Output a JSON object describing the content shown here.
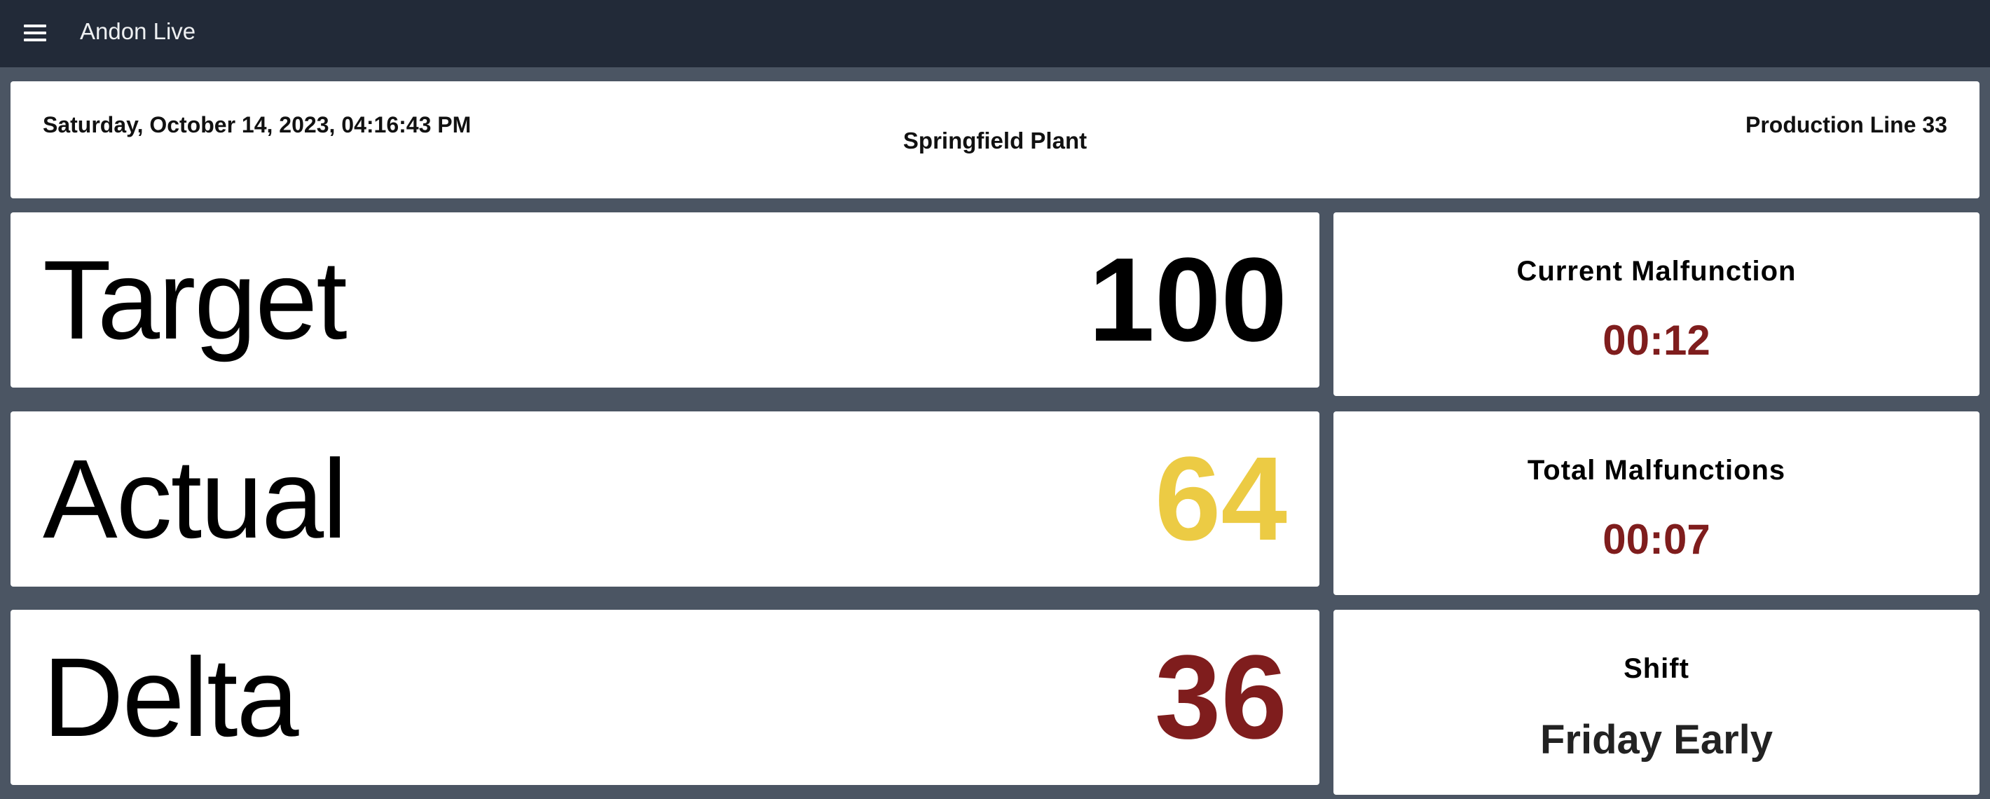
{
  "app": {
    "title": "Andon Live",
    "menu_icon": "menu-icon"
  },
  "header": {
    "datetime": "Saturday, October 14, 2023, 04:16:43 PM",
    "plant": "Springfield Plant",
    "line": "Production Line 33"
  },
  "metrics": [
    {
      "label": "Target",
      "value": "100",
      "color": "#000000"
    },
    {
      "label": "Actual",
      "value": "64",
      "color": "#eccb44"
    },
    {
      "label": "Delta",
      "value": "36",
      "color": "#7f1d1d"
    }
  ],
  "side": {
    "current_malfunction": {
      "title": "Current Malfunction",
      "value": "00:12",
      "color": "#7f1d1d"
    },
    "total_malfunctions": {
      "title": "Total Malfunctions",
      "value": "00:07",
      "color": "#7f1d1d"
    },
    "shift": {
      "title": "Shift",
      "value": "Friday Early"
    }
  },
  "colors": {
    "appbar": "#222a38",
    "background": "#4b5563",
    "card": "#ffffff"
  }
}
